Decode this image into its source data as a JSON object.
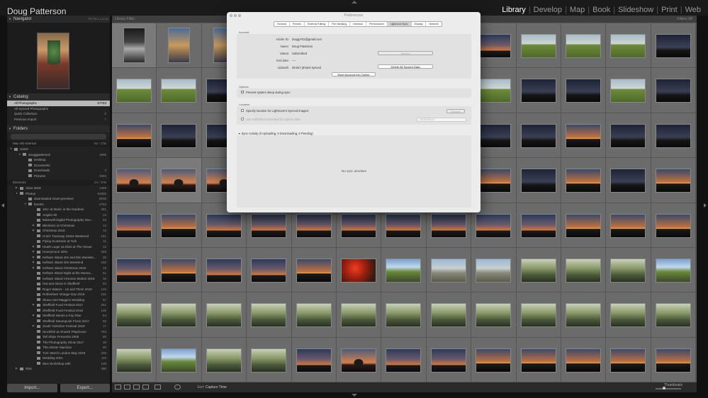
{
  "topbar": {
    "owner": "Doug Patterson",
    "modules": [
      "Library",
      "Develop",
      "Map",
      "Book",
      "Slideshow",
      "Print",
      "Web"
    ],
    "active_module": "Library"
  },
  "navigator": {
    "title": "Navigator",
    "options": "FIT  FILL  1:1  3:1"
  },
  "catalog": {
    "title": "Catalog",
    "items": [
      {
        "label": "All Photographs",
        "count": "67783"
      },
      {
        "label": "All Synced Photographs",
        "count": ""
      },
      {
        "label": "Quick Collection",
        "count": "0"
      },
      {
        "label": "Previous Import",
        "count": "7"
      }
    ]
  },
  "folders": {
    "title": "Folders",
    "volume1": {
      "label": "Mac HD-Internal",
      "count": "62 / 1TB"
    },
    "tree1": [
      {
        "label": "Users",
        "count": ""
      },
      {
        "label": "douggpatterson",
        "count": "1996"
      },
      {
        "label": "Desktop",
        "count": ""
      },
      {
        "label": "Documents",
        "count": ""
      },
      {
        "label": "Downloads",
        "count": "3"
      },
      {
        "label": "Pictures",
        "count": "1993"
      }
    ],
    "volume2": {
      "label": "Elements",
      "count": "24 / 4TB"
    },
    "tree2": [
      {
        "label": "Alvar 2019",
        "count": "1358"
      },
      {
        "label": "Photos",
        "count": "64826"
      },
      {
        "label": "downloaded smart previews",
        "count": "8536"
      },
      {
        "label": "Events",
        "count": "4782"
      },
      {
        "label": "10cc at Music in the Gardens",
        "count": "281"
      },
      {
        "label": "Angelo 90",
        "count": "14"
      },
      {
        "label": "Bakewell Digital Photography Wor...",
        "count": "93"
      },
      {
        "label": "Blenheim at Christmas",
        "count": "14"
      },
      {
        "label": "Christmas 2018",
        "count": "13"
      },
      {
        "label": "Critch Tramway 1940s Weekend",
        "count": "181"
      },
      {
        "label": "Flying Scotsman at York",
        "count": "11"
      },
      {
        "label": "Heath Leger as Elvis at The Venue",
        "count": "12"
      },
      {
        "label": "Honeymoon 2001",
        "count": "269"
      },
      {
        "label": "Kelham Island 40s and 50s Weeken...",
        "count": "30"
      },
      {
        "label": "Kelham Island 40s Weekend",
        "count": "246"
      },
      {
        "label": "Kelham Island Christmas 2016",
        "count": "19"
      },
      {
        "label": "Kelham Island Night at the Museu...",
        "count": "61"
      },
      {
        "label": "Kelham Island Victorian Market 2019",
        "count": "36"
      },
      {
        "label": "Out and About in Sheffield",
        "count": "82"
      },
      {
        "label": "Roger Waters - Us and Them 2018",
        "count": "134"
      },
      {
        "label": "Rotherham Vintage Day 2019",
        "count": "231"
      },
      {
        "label": "Shaun and Maggies Wedding",
        "count": "67"
      },
      {
        "label": "Sheffield Food Festival 2017",
        "count": "251"
      },
      {
        "label": "Sheffield Food Festival 2018",
        "count": "106"
      },
      {
        "label": "Sheffield Needs a Fay Rise",
        "count": "54"
      },
      {
        "label": "Sheffield Steampunk Picnic 2017",
        "count": "55"
      },
      {
        "label": "South Yorkshire Festival 2019",
        "count": "17"
      },
      {
        "label": "Stockfish at Alnwick Playhouse",
        "count": "783"
      },
      {
        "label": "Tall Ships Fireworks 2005",
        "count": "80"
      },
      {
        "label": "The Photography Show 2017",
        "count": "26"
      },
      {
        "label": "This Winter Machine",
        "count": "90"
      },
      {
        "label": "TUC March London May 2018",
        "count": "209"
      },
      {
        "label": "Wedding 2001",
        "count": "115"
      },
      {
        "label": "Wex Workshop with",
        "count": "108"
      },
      {
        "label": "Misc",
        "count": "386"
      }
    ]
  },
  "buttons": {
    "import": "Import...",
    "export": "Export..."
  },
  "library": {
    "filter_label": "Library Filter :",
    "filter_right": "Filters Off",
    "sort_prefix": "Sort:",
    "sort_value": "Capture Time",
    "thumb_label": "Thumbnails"
  },
  "prefs": {
    "title": "Preferences",
    "tabs": [
      "General",
      "Presets",
      "External Editing",
      "File Handling",
      "Interface",
      "Performance",
      "Lightroom Sync",
      "Display",
      "Network"
    ],
    "active_tab": "Lightroom Sync",
    "account_label": "Account",
    "adobe_id_k": "Adobe ID:",
    "adobe_id_v": "dougp761@gmail.com",
    "name_k": "Name:",
    "name_v": "Doug Patterson",
    "status_k": "Status:",
    "status_v": "Subscribed",
    "enddate_k": "End date:",
    "enddate_v": "----",
    "uploads_k": "Uploads:",
    "uploads_v": "39,847 photos synced",
    "renew_btn": "Renew",
    "delete_btn": "Delete All Synced Data",
    "more_btn": "More Account Info Online",
    "options_label": "Options",
    "prevent_sleep": "Prevent system sleep during sync",
    "location_label": "Location",
    "specify_location": "Specify location for Lightroom's Synced images:",
    "choose_btn": "Choose",
    "use_subfolders": "Use subfolders formatted by capture date:",
    "date_format": "2018/2018-07",
    "sync_activity": "Sync Activity  (0 Uploading, 0 Downloading, 0 Pending)",
    "no_sync": "No sync activities"
  },
  "grid_photos": [
    "p-bridge portrait",
    "p-city portrait",
    "p-city portrait",
    "",
    "",
    "",
    "",
    "",
    "p-dusk",
    "p-field",
    "p-field",
    "p-field",
    "p-dark",
    "p-field",
    "p-field",
    "p-dark",
    "",
    "",
    "",
    "",
    "",
    "p-field",
    "p-dark",
    "p-dark",
    "p-field",
    "p-dark",
    "p-sunset",
    "p-dark",
    "p-dark",
    "",
    "",
    "",
    "",
    "",
    "p-dark",
    "p-dark",
    "p-sunset",
    "p-dark",
    "p-dark",
    "p-tree",
    "p-tree",
    "p-tree",
    "",
    "",
    "",
    "",
    "",
    "p-sunset",
    "p-dark",
    "p-sunset",
    "p-dark",
    "p-sunset",
    "p-dusk",
    "p-sunset",
    "p-dusk",
    "p-dusk",
    "p-dusk",
    "p-dusk",
    "p-dusk",
    "p-dusk",
    "p-dusk",
    "p-dusk",
    "p-sunset",
    "p-sunset",
    "p-sunset",
    "p-dusk",
    "p-sunset",
    "p-dusk",
    "p-dusk",
    "p-sunset",
    "p-red",
    "p-spring",
    "p-rail",
    "p-rail",
    "p-woods",
    "p-woods",
    "p-woods",
    "p-spring",
    "p-woods",
    "p-woods",
    "p-woods",
    "p-woods",
    "p-woods",
    "p-woods",
    "p-woods",
    "p-woods",
    "p-woods",
    "p-woods",
    "p-woods",
    "p-woods",
    "p-woods",
    "p-woods",
    "p-spring",
    "p-woods",
    "p-woods",
    "p-dusk",
    "p-tree",
    "p-dusk",
    "p-dusk",
    "p-sunset",
    "p-sunset",
    "p-sunset",
    "p-sunset",
    "p-sunset"
  ]
}
